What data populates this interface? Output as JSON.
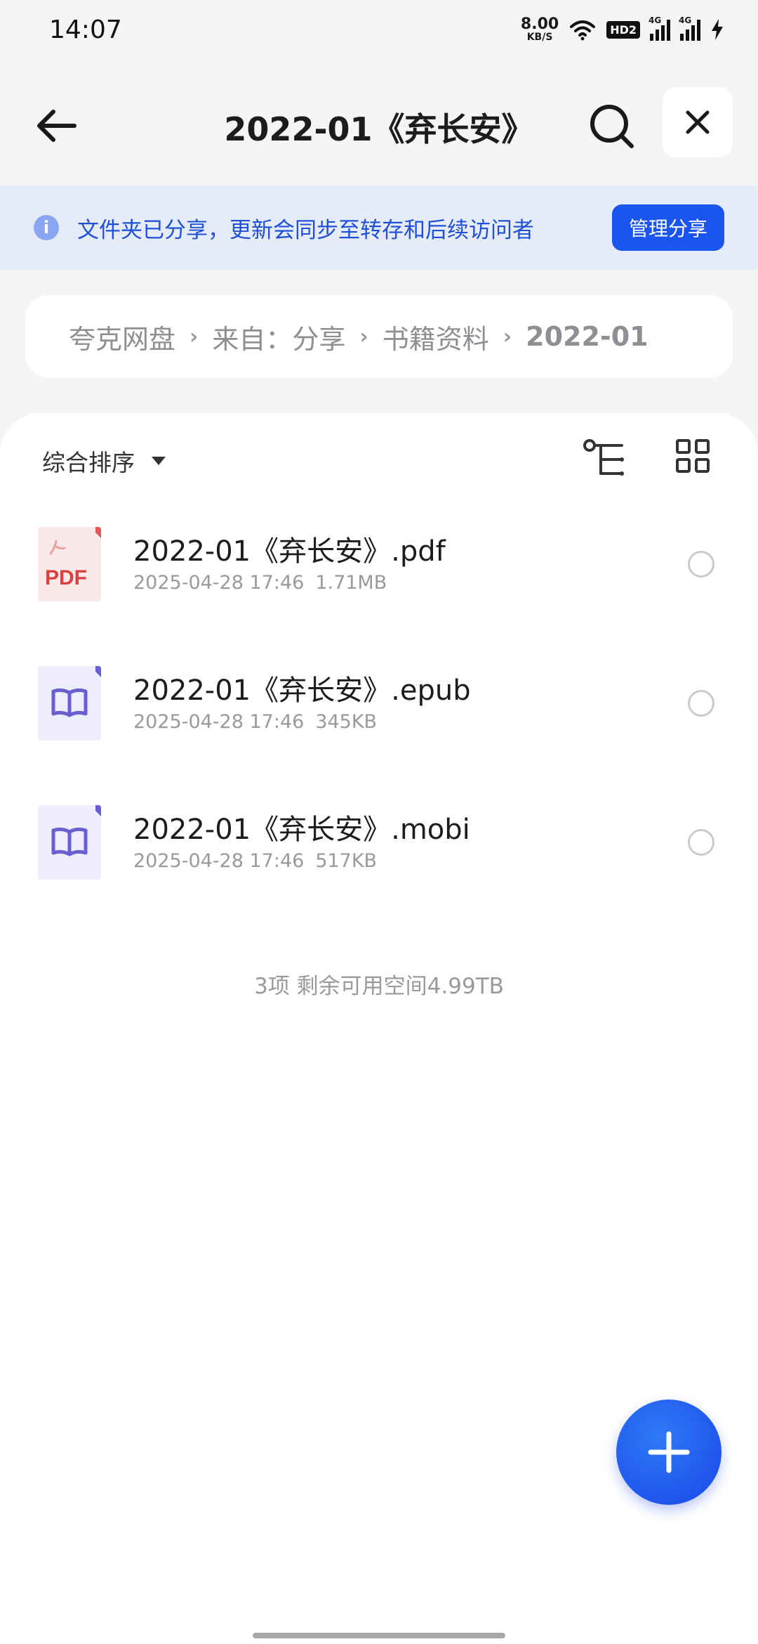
{
  "status_bar": {
    "time": "14:07",
    "net_speed_value": "8.00",
    "net_speed_unit": "KB/S",
    "hd_badge": "HD2",
    "signal_1_label": "4G",
    "signal_2_label": "4G",
    "icons": [
      "wifi-icon",
      "signal-icon",
      "charging-icon"
    ]
  },
  "header": {
    "title": "2022-01《弃长安》",
    "icons": [
      "back-arrow-icon",
      "search-icon",
      "close-icon"
    ]
  },
  "share_banner": {
    "text": "文件夹已分享，更新会同步至转存和后续访问者",
    "button_label": "管理分享",
    "info_glyph": "i"
  },
  "breadcrumb": {
    "items": [
      "夸克网盘",
      "来自：分享",
      "书籍资料",
      "2022-01"
    ],
    "separator": "›"
  },
  "toolbar": {
    "sort_label": "综合排序",
    "icons": [
      "tree-view-icon",
      "grid-view-icon"
    ]
  },
  "files": [
    {
      "name": "2022-01《弃长安》.pdf",
      "date": "2025-04-28 17:46",
      "size": "1.71MB",
      "type": "pdf",
      "badge": "PDF"
    },
    {
      "name": "2022-01《弃长安》.epub",
      "date": "2025-04-28 17:46",
      "size": "345KB",
      "type": "book"
    },
    {
      "name": "2022-01《弃长安》.mobi",
      "date": "2025-04-28 17:46",
      "size": "517KB",
      "type": "book"
    }
  ],
  "summary": "3项 剩余可用空间4.99TB",
  "fab": {
    "icon": "plus-icon"
  },
  "colors": {
    "accent": "#1b55f0",
    "banner_bg": "#e6ebf8",
    "banner_text": "#1f50d6",
    "pdf_red": "#d9403f",
    "book_purple": "#6a5fd0"
  }
}
